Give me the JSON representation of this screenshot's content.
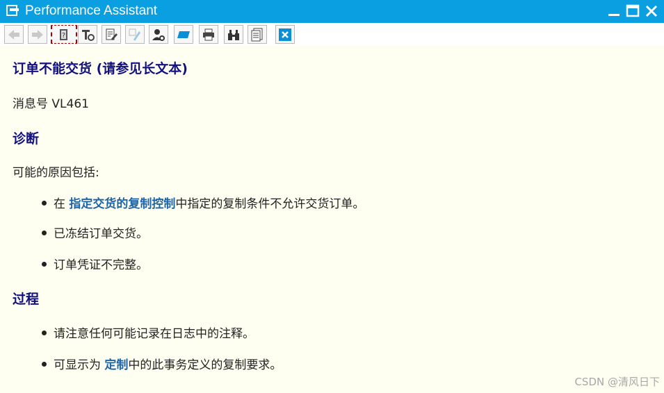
{
  "window": {
    "title": "Performance Assistant"
  },
  "toolbar": {
    "buttons": [
      {
        "name": "back-button",
        "icon": "arrow-left-icon",
        "enabled": false
      },
      {
        "name": "forward-button",
        "icon": "arrow-right-icon",
        "enabled": false
      },
      {
        "name": "help-book-button",
        "icon": "help-book-icon",
        "enabled": true,
        "active": true
      },
      {
        "name": "technical-info-button",
        "icon": "tools-icon",
        "enabled": true
      },
      {
        "name": "edit-button",
        "icon": "edit-icon",
        "enabled": true
      },
      {
        "name": "highlight-button",
        "icon": "pen-icon",
        "enabled": false
      },
      {
        "name": "user-key-button",
        "icon": "user-key-icon",
        "enabled": true
      },
      {
        "name": "display-button",
        "icon": "folder-icon",
        "enabled": true
      },
      {
        "name": "print-button",
        "icon": "printer-icon",
        "enabled": true
      },
      {
        "name": "find-button",
        "icon": "binoculars-icon",
        "enabled": true
      },
      {
        "name": "notes-button",
        "icon": "document-icon",
        "enabled": true
      },
      {
        "name": "close-help-button",
        "icon": "close-icon",
        "enabled": true
      }
    ]
  },
  "doc": {
    "title": "订单不能交货 (请参见长文本)",
    "message_no": "消息号 VL461",
    "diagnosis_heading": "诊断",
    "diagnosis_intro": "可能的原因包括:",
    "causes": {
      "c1_prefix": "在 ",
      "c1_link": "指定交货的复制控制",
      "c1_suffix": "中指定的复制条件不允许交货订单。",
      "c2": "已冻结订单交货。",
      "c3": "订单凭证不完整。"
    },
    "procedure_heading": "过程",
    "steps": {
      "s1": "请注意任何可能记录在日志中的注释。",
      "s2_prefix": "可显示为 ",
      "s2_link": "定制",
      "s2_suffix": "中的此事务定义的复制要求。"
    }
  },
  "watermark": "CSDN @清风日下",
  "colors": {
    "titlebar": "#0a9fe0",
    "heading": "#131082",
    "link": "#1d64a8",
    "background": "#fefff0"
  }
}
